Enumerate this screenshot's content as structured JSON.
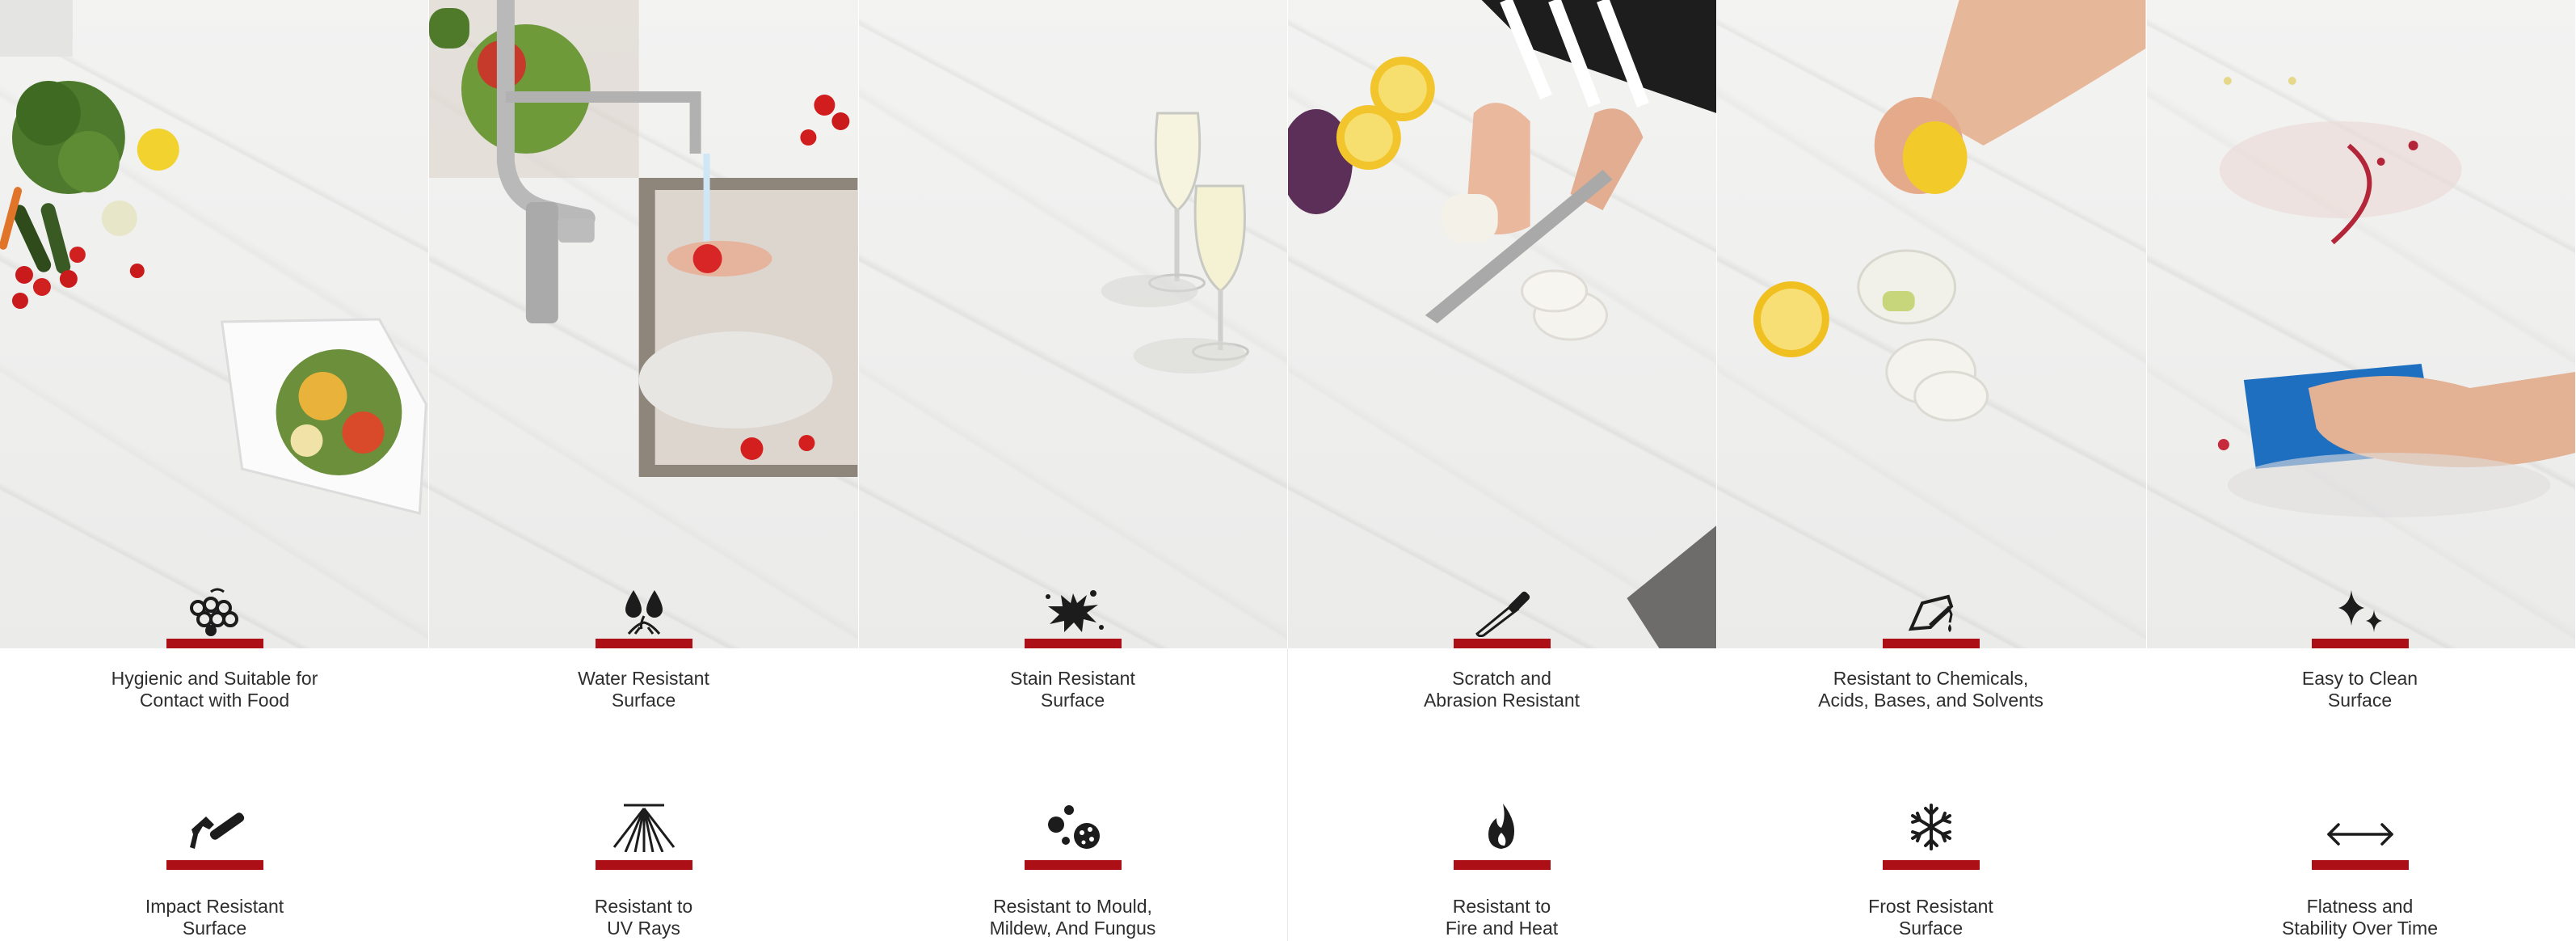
{
  "accent_color": "#ad0f16",
  "photos": [
    {
      "name": "vegetables-and-salad"
    },
    {
      "name": "sink-tap-washing-fruit"
    },
    {
      "name": "wine-glasses"
    },
    {
      "name": "knife-cutting-on-counter"
    },
    {
      "name": "lemon-squeeze"
    },
    {
      "name": "cloth-wiping"
    }
  ],
  "features": [
    {
      "icon": "grapes-icon",
      "lines": [
        "Hygienic and Suitable for",
        "Contact with Food"
      ]
    },
    {
      "icon": "water-drops-icon",
      "lines": [
        "Water Resistant",
        "Surface"
      ]
    },
    {
      "icon": "stain-splat-icon",
      "lines": [
        "Stain Resistant",
        "Surface"
      ]
    },
    {
      "icon": "knife-icon",
      "lines": [
        "Scratch and",
        "Abrasion Resistant"
      ]
    },
    {
      "icon": "chemical-beaker-icon",
      "lines": [
        "Resistant to Chemicals,",
        "Acids, Bases, and Solvents"
      ]
    },
    {
      "icon": "sparkles-icon",
      "lines": [
        "Easy to Clean",
        "Surface"
      ]
    },
    {
      "icon": "hammer-icon",
      "lines": [
        "Impact Resistant",
        "Surface"
      ]
    },
    {
      "icon": "uv-rays-icon",
      "lines": [
        "Resistant to",
        "UV Rays"
      ]
    },
    {
      "icon": "mould-spores-icon",
      "lines": [
        "Resistant to Mould,",
        "Mildew, And Fungus"
      ]
    },
    {
      "icon": "flame-icon",
      "lines": [
        "Resistant to",
        "Fire and Heat"
      ]
    },
    {
      "icon": "snowflake-icon",
      "lines": [
        "Frost Resistant",
        "Surface"
      ]
    },
    {
      "icon": "two-way-arrow-icon",
      "lines": [
        "Flatness and",
        "Stability Over Time"
      ]
    }
  ]
}
